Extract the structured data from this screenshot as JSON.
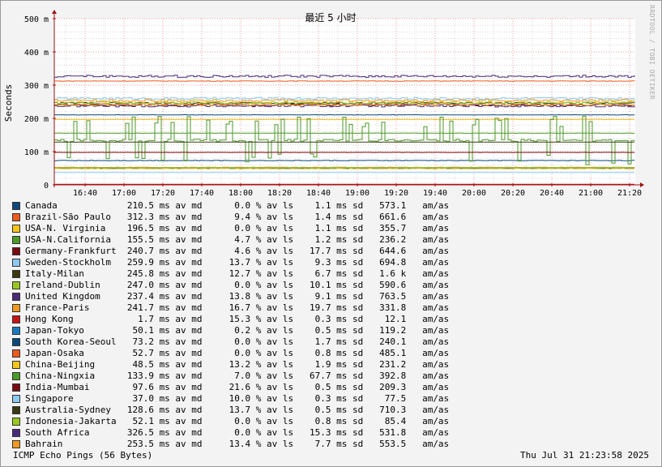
{
  "chart_data": {
    "type": "line",
    "title": "最近 5 小时",
    "ylabel": "Seconds",
    "y_unit": "m",
    "ylim": [
      0,
      500
    ],
    "y_ticks": [
      {
        "value": 0,
        "label": "0"
      },
      {
        "value": 100,
        "label": "100 m"
      },
      {
        "value": 200,
        "label": "200 m"
      },
      {
        "value": 300,
        "label": "300 m"
      },
      {
        "value": 400,
        "label": "400 m"
      },
      {
        "value": 500,
        "label": "500 m"
      }
    ],
    "x_ticks": [
      "16:40",
      "17:00",
      "17:20",
      "17:40",
      "18:00",
      "18:20",
      "18:40",
      "19:00",
      "19:20",
      "19:40",
      "20:00",
      "20:20",
      "20:40",
      "21:00",
      "21:20"
    ],
    "grid": true,
    "legend_placement": "bottom",
    "series": [
      {
        "name": "Canada",
        "color": "#0a4a7a",
        "median": "210.5",
        "median_unit": "ms av md",
        "loss": "0.0",
        "loss_unit": "% av ls",
        "sd": "1.1",
        "sd_unit": "ms sd",
        "amas": "573.1",
        "amas_unit": "am/as"
      },
      {
        "name": "Brazil-São Paulo",
        "color": "#f05a1c",
        "median": "312.3",
        "median_unit": "ms av md",
        "loss": "9.4",
        "loss_unit": "% av ls",
        "sd": "1.4",
        "sd_unit": "ms sd",
        "amas": "661.6",
        "amas_unit": "am/as"
      },
      {
        "name": "USA-N. Virginia",
        "color": "#f5c518",
        "median": "196.5",
        "median_unit": "ms av md",
        "loss": "0.0",
        "loss_unit": "% av ls",
        "sd": "1.1",
        "sd_unit": "ms sd",
        "amas": "355.7",
        "amas_unit": "am/as"
      },
      {
        "name": "USA-N.California",
        "color": "#4c9a2a",
        "median": "155.5",
        "median_unit": "ms av md",
        "loss": "4.7",
        "loss_unit": "% av ls",
        "sd": "1.2",
        "sd_unit": "ms sd",
        "amas": "236.2",
        "amas_unit": "am/as"
      },
      {
        "name": "Germany-Frankfurt",
        "color": "#7a0a14",
        "median": "240.7",
        "median_unit": "ms av md",
        "loss": "4.6",
        "loss_unit": "% av ls",
        "sd": "17.7",
        "sd_unit": "ms sd",
        "amas": "644.6",
        "amas_unit": "am/as"
      },
      {
        "name": "Sweden-Stockholm",
        "color": "#8ec9f2",
        "median": "259.9",
        "median_unit": "ms av md",
        "loss": "13.7",
        "loss_unit": "% av ls",
        "sd": "9.3",
        "sd_unit": "ms sd",
        "amas": "694.8",
        "amas_unit": "am/as"
      },
      {
        "name": "Italy-Milan",
        "color": "#3a3a10",
        "median": "245.8",
        "median_unit": "ms av md",
        "loss": "12.7",
        "loss_unit": "% av ls",
        "sd": "6.7",
        "sd_unit": "ms sd",
        "amas": "1.6 k",
        "amas_unit": "am/as"
      },
      {
        "name": "Ireland-Dublin",
        "color": "#9ac820",
        "median": "247.0",
        "median_unit": "ms av md",
        "loss": "0.0",
        "loss_unit": "% av ls",
        "sd": "10.1",
        "sd_unit": "ms sd",
        "amas": "590.6",
        "amas_unit": "am/as"
      },
      {
        "name": "United Kingdom",
        "color": "#4a2a7a",
        "median": "237.4",
        "median_unit": "ms av md",
        "loss": "13.8",
        "loss_unit": "% av ls",
        "sd": "9.1",
        "sd_unit": "ms sd",
        "amas": "763.5",
        "amas_unit": "am/as"
      },
      {
        "name": "France-Paris",
        "color": "#f59a1c",
        "median": "241.7",
        "median_unit": "ms av md",
        "loss": "16.7",
        "loss_unit": "% av ls",
        "sd": "19.7",
        "sd_unit": "ms sd",
        "amas": "331.8",
        "amas_unit": "am/as"
      },
      {
        "name": "Hong Kong",
        "color": "#c81414",
        "median": "1.7",
        "median_unit": "ms av md",
        "loss": "15.3",
        "loss_unit": "% av ls",
        "sd": "0.3",
        "sd_unit": "ms sd",
        "amas": "12.1",
        "amas_unit": "am/as"
      },
      {
        "name": "Japan-Tokyo",
        "color": "#1a7ac0",
        "median": "50.1",
        "median_unit": "ms av md",
        "loss": "0.2",
        "loss_unit": "% av ls",
        "sd": "0.5",
        "sd_unit": "ms sd",
        "amas": "119.2",
        "amas_unit": "am/as"
      },
      {
        "name": "South Korea-Seoul",
        "color": "#0a4a7a",
        "median": "73.2",
        "median_unit": "ms av md",
        "loss": "0.0",
        "loss_unit": "% av ls",
        "sd": "1.7",
        "sd_unit": "ms sd",
        "amas": "240.1",
        "amas_unit": "am/as"
      },
      {
        "name": "Japan-Osaka",
        "color": "#f05a1c",
        "median": "52.7",
        "median_unit": "ms av md",
        "loss": "0.0",
        "loss_unit": "% av ls",
        "sd": "0.8",
        "sd_unit": "ms sd",
        "amas": "485.1",
        "amas_unit": "am/as"
      },
      {
        "name": "China-Beijing",
        "color": "#f5c518",
        "median": "48.5",
        "median_unit": "ms av md",
        "loss": "13.2",
        "loss_unit": "% av ls",
        "sd": "1.9",
        "sd_unit": "ms sd",
        "amas": "231.2",
        "amas_unit": "am/as"
      },
      {
        "name": "China-Ningxia",
        "color": "#4c9a2a",
        "median": "133.9",
        "median_unit": "ms av md",
        "loss": "7.0",
        "loss_unit": "% av ls",
        "sd": "67.7",
        "sd_unit": "ms sd",
        "amas": "392.8",
        "amas_unit": "am/as"
      },
      {
        "name": "India-Mumbai",
        "color": "#7a0a14",
        "median": "97.6",
        "median_unit": "ms av md",
        "loss": "21.6",
        "loss_unit": "% av ls",
        "sd": "0.5",
        "sd_unit": "ms sd",
        "amas": "209.3",
        "amas_unit": "am/as"
      },
      {
        "name": "Singapore",
        "color": "#8ec9f2",
        "median": "37.0",
        "median_unit": "ms av md",
        "loss": "10.0",
        "loss_unit": "% av ls",
        "sd": "0.3",
        "sd_unit": "ms sd",
        "amas": "77.5",
        "amas_unit": "am/as"
      },
      {
        "name": "Australia-Sydney",
        "color": "#3a3a10",
        "median": "128.6",
        "median_unit": "ms av md",
        "loss": "13.7",
        "loss_unit": "% av ls",
        "sd": "0.5",
        "sd_unit": "ms sd",
        "amas": "710.3",
        "amas_unit": "am/as"
      },
      {
        "name": "Indonesia-Jakarta",
        "color": "#9ac820",
        "median": "52.1",
        "median_unit": "ms av md",
        "loss": "0.0",
        "loss_unit": "% av ls",
        "sd": "0.8",
        "sd_unit": "ms sd",
        "amas": "85.4",
        "amas_unit": "am/as"
      },
      {
        "name": "South Africa",
        "color": "#4a2a7a",
        "median": "326.5",
        "median_unit": "ms av md",
        "loss": "0.0",
        "loss_unit": "% av ls",
        "sd": "15.3",
        "sd_unit": "ms sd",
        "amas": "531.8",
        "amas_unit": "am/as"
      },
      {
        "name": "Bahrain",
        "color": "#f59a1c",
        "median": "253.5",
        "median_unit": "ms av md",
        "loss": "13.4",
        "loss_unit": "% av ls",
        "sd": "7.7",
        "sd_unit": "ms sd",
        "amas": "553.5",
        "amas_unit": "am/as"
      }
    ]
  },
  "footer": {
    "left": "ICMP Echo Pings (56 Bytes)",
    "right": "Thu Jul 31 21:23:58 2025"
  },
  "watermark": "RRDTOOL / TOBI OETIKER",
  "colors": {
    "background": "#f3f3f3",
    "plot_background": "#ffffff",
    "grid_major": "#e8a0a0",
    "grid_minor": "#d8d8d8",
    "axis": "#a01010"
  }
}
